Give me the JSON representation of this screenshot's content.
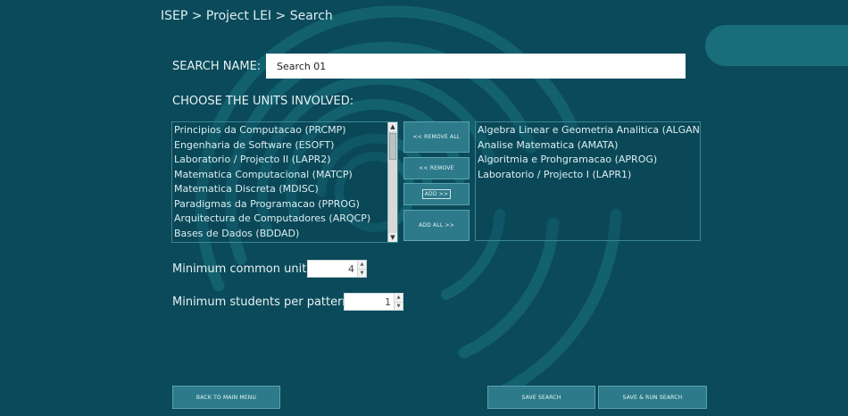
{
  "breadcrumb": "ISEP > Project LEI > Search",
  "search": {
    "label": "SEARCH NAME:",
    "value": "Search 01"
  },
  "units_heading": "CHOOSE THE UNITS INVOLVED:",
  "available_units": [
    "Principios da Computacao (PRCMP)",
    "Engenharia de Software (ESOFT)",
    "Laboratorio / Projecto II (LAPR2)",
    "Matematica Computacional (MATCP)",
    "Matematica Discreta (MDISC)",
    "Paradigmas da Programacao (PPROG)",
    "Arquitectura de Computadores (ARQCP)",
    "Bases de Dados (BDDAD)"
  ],
  "selected_units": [
    "Algebra Linear e Geometria Analitica (ALGAN)",
    "Analise Matematica (AMATA)",
    "Algoritmia e Prohgramacao (APROG)",
    "Laboratorio / Projecto I (LAPR1)"
  ],
  "transfer_buttons": {
    "remove_all": "<< REMOVE ALL",
    "remove": "<< REMOVE",
    "add": "ADD >>",
    "add_all": "ADD ALL >>"
  },
  "min_common_units": {
    "label": "Minimum common units:",
    "value": "4"
  },
  "min_students": {
    "label": "Minimum students per pattern:",
    "value": "1"
  },
  "footer": {
    "back": "BACK TO MAIN MENU",
    "save": "SAVE SEARCH",
    "save_run": "SAVE & RUN SEARCH"
  },
  "colors": {
    "background": "#0b4a5a",
    "button": "#2d7b8a",
    "pill": "#1a6e7c"
  }
}
